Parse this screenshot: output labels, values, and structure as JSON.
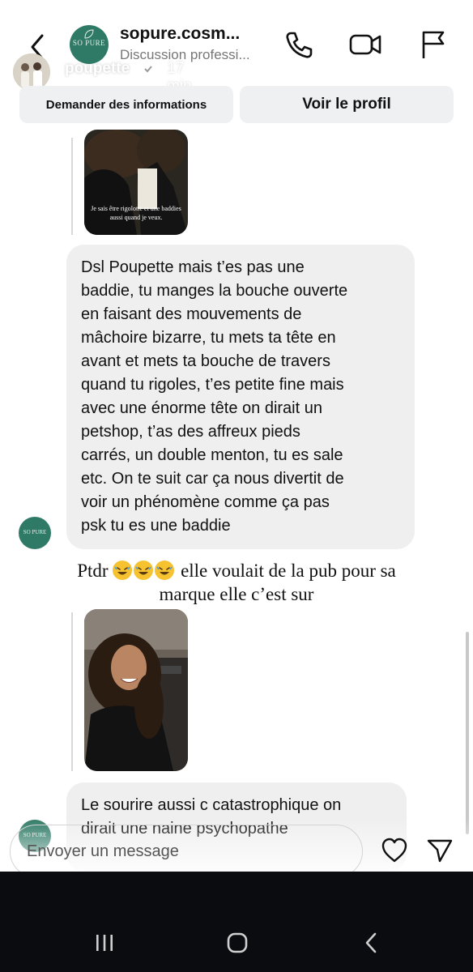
{
  "header": {
    "thread_name": "sopure.cosm...",
    "thread_subtitle": "Discussion professi...",
    "brand_logo_text": "SO PURE"
  },
  "story": {
    "username": "poupette",
    "time_ago": "17 min",
    "verified": true
  },
  "actions": {
    "request_info": "Demander des informations",
    "view_profile": "Voir le profil"
  },
  "messages": {
    "story_reply_1_overlay": "Je sais être rigolotte et une baddies aussi quand je veux.",
    "bubble_1_lines": [
      "Dsl Poupette mais t’es pas une",
      "baddie, tu manges la bouche ouverte",
      "en faisant des mouvements de",
      "mâchoire bizarre, tu mets ta tête en",
      "avant et mets ta bouche de travers",
      "quand tu rigoles, t’es petite fine mais",
      "avec une énorme tête on dirait un",
      "petshop, t’as des affreux pieds",
      "carrés, un double menton, tu es sale",
      "etc. On te suit car ça nous divertit de",
      "voir un phénomène comme ça pas",
      "psk tu es une baddie"
    ],
    "bubble_2_lines": [
      "Le sourire aussi c catastrophique on",
      "dirait une naine psychopathe"
    ],
    "sender_logo_text": "SO PURE"
  },
  "caption": {
    "prefix": "Ptdr",
    "emoji_count": 3,
    "suffix": "elle voulait de la pub pour sa",
    "line2": "marque elle c’est sur"
  },
  "composer": {
    "placeholder": "Envoyer un message"
  },
  "colors": {
    "brand_green": "#2f7a66",
    "bubble_gray": "#efefef",
    "nav_bar": "#0b0c0f"
  },
  "icons": [
    "back-chevron-icon",
    "phone-icon",
    "video-camera-icon",
    "flag-icon",
    "verified-badge-icon",
    "more-icon",
    "heart-icon",
    "send-icon",
    "recents-icon",
    "home-icon",
    "back-icon"
  ]
}
